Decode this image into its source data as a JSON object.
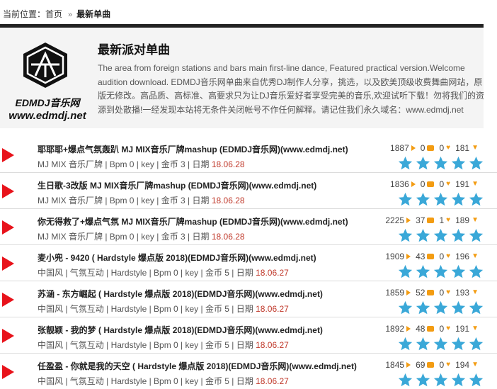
{
  "breadcrumb": {
    "prefix": "当前位置：",
    "home": "首页",
    "separator": "»",
    "current": "最新单曲"
  },
  "intro": {
    "logo_text1": "EDMDJ音乐网",
    "logo_text2": "www.edmdj.net",
    "title": "最新派对单曲",
    "description": "The area from foreign stations and bars main first-line dance, Featured practical version.Welcome audition download. EDMDJ音乐网单曲来自优秀DJ制作人分享，挑选，以及欧美顶级收费舞曲网站，原版无修改。高品质、高标准、高要求只为让DJ音乐爱好者享受完美的音乐,欢迎试听下载！勿将我们的资源到处散播!一经发现本站将无条件关闭帐号不作任何解释。请记住我们永久域名：www.edmdj.net"
  },
  "colors": {
    "play": "#e8131b",
    "accent": "#f39c12",
    "star": "#3aa8d8",
    "date": "#c0392b"
  },
  "tracks": [
    {
      "title": "耶耶耶+爆点气氛轰趴 MJ MIX音乐厂牌mashup (EDMDJ音乐网)(www.edmdj.net)",
      "meta": "MJ MIX 音乐厂牌 | Bpm 0 | key | 金币 3 | 日期 ",
      "date": "18.06.28",
      "plays": "1887",
      "comments": "0",
      "likes": "0",
      "downloads": "181",
      "rating": 5
    },
    {
      "title": "生日歌-3改版 MJ MIX音乐厂牌mashup (EDMDJ音乐网)(www.edmdj.net)",
      "meta": "MJ MIX 音乐厂牌 | Bpm 0 | key | 金币 3 | 日期 ",
      "date": "18.06.28",
      "plays": "1836",
      "comments": "0",
      "likes": "0",
      "downloads": "191",
      "rating": 5
    },
    {
      "title": "你无得救了+爆点气氛 MJ MIX音乐厂牌mashup (EDMDJ音乐网)(www.edmdj.net)",
      "meta": "MJ MIX 音乐厂牌 | Bpm 0 | key | 金币 3 | 日期 ",
      "date": "18.06.28",
      "plays": "2225",
      "comments": "37",
      "likes": "1",
      "downloads": "189",
      "rating": 5
    },
    {
      "title": "麦小兜 - 9420 ( Hardstyle 爆点版 2018)(EDMDJ音乐网)(www.edmdj.net)",
      "meta": "中国风 | 气氛互动 | Hardstyle | Bpm 0 | key | 金币 5 | 日期 ",
      "date": "18.06.27",
      "plays": "1909",
      "comments": "43",
      "likes": "0",
      "downloads": "196",
      "rating": 5
    },
    {
      "title": "苏涵 - 东方崛起 ( Hardstyle 爆点版 2018)(EDMDJ音乐网)(www.edmdj.net)",
      "meta": "中国风 | 气氛互动 | Hardstyle | Bpm 0 | key | 金币 5 | 日期 ",
      "date": "18.06.27",
      "plays": "1859",
      "comments": "52",
      "likes": "0",
      "downloads": "193",
      "rating": 5
    },
    {
      "title": "张靓颖 - 我的梦 ( Hardstyle 爆点版 2018)(EDMDJ音乐网)(www.edmdj.net)",
      "meta": "中国风 | 气氛互动 | Hardstyle | Bpm 0 | key | 金币 5 | 日期 ",
      "date": "18.06.27",
      "plays": "1892",
      "comments": "48",
      "likes": "0",
      "downloads": "191",
      "rating": 5
    },
    {
      "title": "任盈盈 - 你就是我的天空 ( Hardstyle 爆点版 2018)(EDMDJ音乐网)(www.edmdj.net)",
      "meta": "中国风 | 气氛互动 | Hardstyle | Bpm 0 | key | 金币 5 | 日期 ",
      "date": "18.06.27",
      "plays": "1845",
      "comments": "69",
      "likes": "0",
      "downloads": "194",
      "rating": 5
    }
  ]
}
